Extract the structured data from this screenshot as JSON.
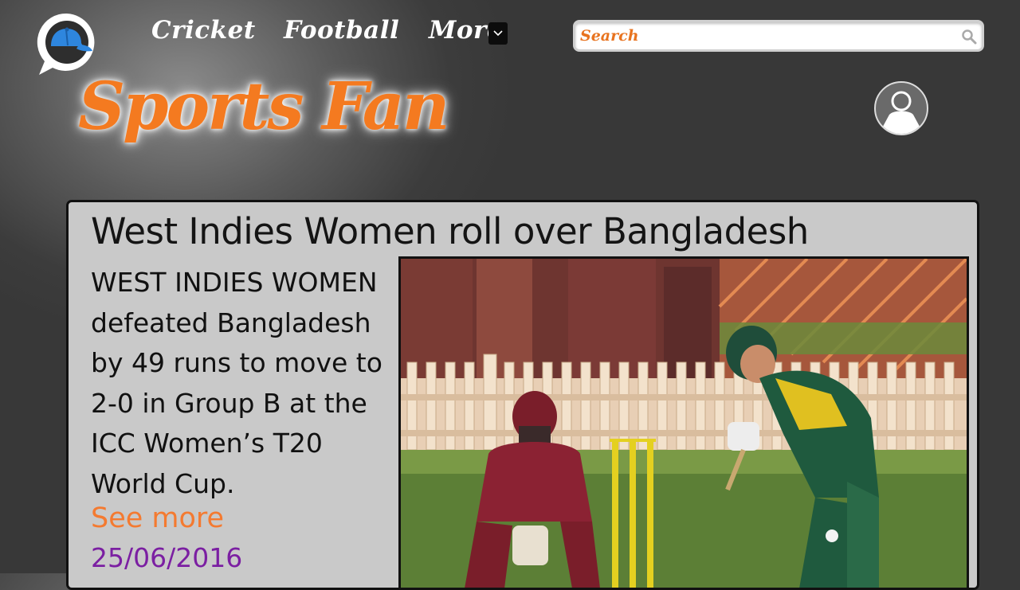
{
  "nav": {
    "items": [
      {
        "label": "Cricket"
      },
      {
        "label": "Football"
      },
      {
        "label": "More"
      }
    ]
  },
  "search": {
    "placeholder": "Search"
  },
  "brand": {
    "title": "Sports Fan"
  },
  "article": {
    "headline": "West Indies Women roll over Bangladesh",
    "body": "WEST INDIES WOMEN defeated Bangladesh by 49 runs to move to 2-0 in Group B at the ICC Women’s T20 World Cup.",
    "see_more": "See more",
    "date": "25/06/2016"
  },
  "icons": {
    "logo": "chat-bubble-cap-icon",
    "more": "chevron-down-icon",
    "search": "search-icon",
    "avatar": "user-avatar-icon"
  },
  "colors": {
    "brand_orange": "#f47a20",
    "date_purple": "#7b1fa2",
    "logo_blue": "#2e86de"
  }
}
